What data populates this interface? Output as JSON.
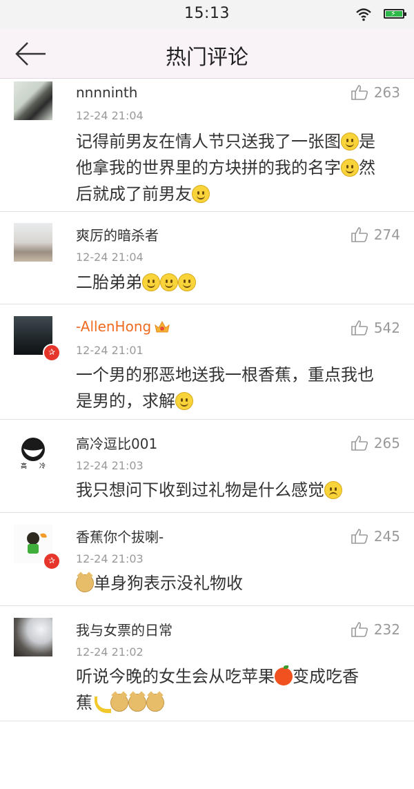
{
  "status_bar": {
    "time": "15:13"
  },
  "header": {
    "title": "热门评论"
  },
  "comments": [
    {
      "username": "nnnninth",
      "time": "12-24 21:04",
      "likes": "263",
      "text": [
        "记得前男友在情人节只送我了一张图",
        "是",
        "他拿我的世界里的方块拼的我的名字",
        "然",
        "后就成了前男友"
      ]
    },
    {
      "username": "爽厉的暗杀者",
      "time": "12-24 21:04",
      "likes": "274",
      "text": [
        "二胎弟弟"
      ]
    },
    {
      "username": "-AllenHong",
      "time": "12-24 21:01",
      "likes": "542",
      "text": [
        "一个男的邪恶地送我一根香蕉，重点我也",
        "是男的，求解"
      ]
    },
    {
      "username": "高冷逗比001",
      "time": "12-24 21:03",
      "likes": "265",
      "text": [
        "我只想问下收到过礼物是什么感觉"
      ],
      "avatar_text": [
        "高",
        "冷"
      ]
    },
    {
      "username": "香蕉你个拔喇-",
      "time": "12-24 21:03",
      "likes": "245",
      "text": [
        "单身狗表示没礼物收"
      ]
    },
    {
      "username": "我与女票的日常",
      "time": "12-24 21:02",
      "likes": "232",
      "text": [
        "听说今晚的女生会从吃苹果",
        "变成吃香",
        "蕉"
      ]
    }
  ],
  "colors": {
    "highlight_username": "#f06a1f",
    "verified_badge": "#e6362b"
  }
}
